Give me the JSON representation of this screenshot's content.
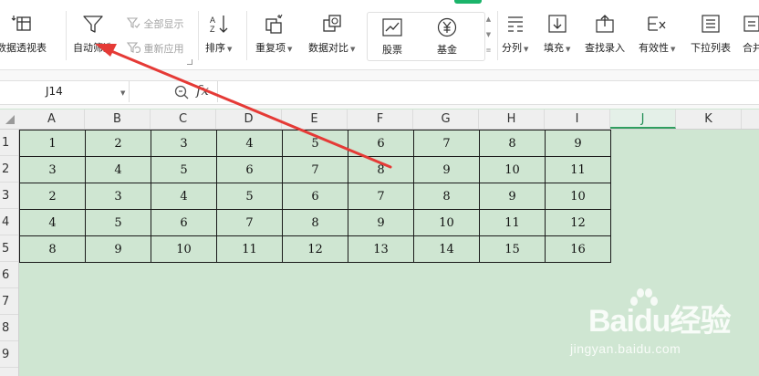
{
  "ribbon": {
    "pivot": {
      "label": "数据透视表",
      "icon": "pivot-table-icon"
    },
    "autofilter": {
      "label": "自动筛选",
      "icon": "filter-funnel-icon"
    },
    "show_all": {
      "label": "全部显示",
      "icon": "show-all-icon"
    },
    "reapply": {
      "label": "重新应用",
      "icon": "reapply-icon"
    },
    "sort": {
      "label": "排序",
      "icon": "sort-icon"
    },
    "duplicates": {
      "label": "重复项",
      "icon": "duplicates-icon"
    },
    "compare": {
      "label": "数据对比",
      "icon": "compare-icon"
    },
    "stocks": {
      "label": "股票",
      "icon": "stock-chart-icon"
    },
    "funds": {
      "label": "基金",
      "icon": "fund-yen-icon"
    },
    "split": {
      "label": "分列",
      "icon": "split-columns-icon"
    },
    "fill": {
      "label": "填充",
      "icon": "fill-down-icon"
    },
    "lookup_entry": {
      "label": "查找录入",
      "icon": "lookup-entry-icon"
    },
    "validity": {
      "label": "有效性",
      "icon": "validity-icon"
    },
    "dropdown_list": {
      "label": "下拉列表",
      "icon": "dropdown-list-icon"
    },
    "merge_calc": {
      "label": "合并",
      "icon": "merge-calc-icon"
    }
  },
  "formula_bar": {
    "cell_ref": "J14",
    "fx": "fx",
    "formula": ""
  },
  "grid": {
    "columns": [
      "A",
      "B",
      "C",
      "D",
      "E",
      "F",
      "G",
      "H",
      "I",
      "J",
      "K"
    ],
    "active_column": "J",
    "rows": [
      "1",
      "2",
      "3",
      "4",
      "5",
      "6",
      "7",
      "8",
      "9"
    ],
    "cells": [
      [
        "1",
        "2",
        "3",
        "4",
        "5",
        "6",
        "7",
        "8",
        "9"
      ],
      [
        "3",
        "4",
        "5",
        "6",
        "7",
        "8",
        "9",
        "10",
        "11"
      ],
      [
        "2",
        "3",
        "4",
        "5",
        "6",
        "7",
        "8",
        "9",
        "10"
      ],
      [
        "4",
        "5",
        "6",
        "7",
        "8",
        "9",
        "10",
        "11",
        "12"
      ],
      [
        "8",
        "9",
        "10",
        "11",
        "12",
        "13",
        "14",
        "15",
        "16"
      ]
    ]
  },
  "watermark": {
    "brand": "Baidu经验",
    "url": "jingyan.baidu.com"
  },
  "colors": {
    "sheet_background": "#cfe6d2",
    "annotation_arrow": "#e53a36",
    "active_header": "#1f8d53"
  }
}
